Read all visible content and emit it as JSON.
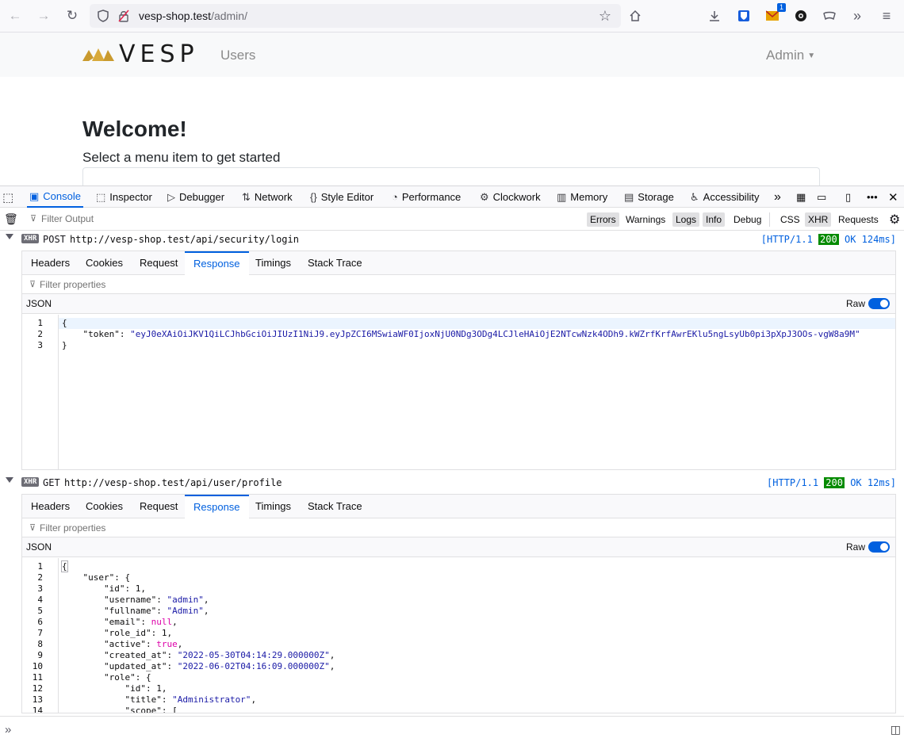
{
  "browser": {
    "url_host": "vesp-shop.test",
    "url_path": "/admin/",
    "extension_badge": "1"
  },
  "app": {
    "brand": "VESP",
    "nav_users": "Users",
    "nav_admin": "Admin"
  },
  "page": {
    "title": "Welcome!",
    "subtitle": "Select a menu item to get started"
  },
  "devtools": {
    "tabs": [
      "Console",
      "Inspector",
      "Debugger",
      "Network",
      "Style Editor",
      "Performance",
      "Clockwork",
      "Memory",
      "Storage",
      "Accessibility"
    ],
    "filter_placeholder": "Filter Output",
    "filters": [
      "Errors",
      "Warnings",
      "Logs",
      "Info",
      "Debug",
      "CSS",
      "XHR",
      "Requests"
    ],
    "active_filters": [
      "Logs",
      "Info",
      "XHR"
    ]
  },
  "requests": [
    {
      "tag": "XHR",
      "method": "POST",
      "url": "http://vesp-shop.test/api/security/login",
      "protocol": "[HTTP/1.1",
      "code": "200",
      "status": "OK 124ms]",
      "tabs": [
        "Headers",
        "Cookies",
        "Request",
        "Response",
        "Timings",
        "Stack Trace"
      ],
      "filter_placeholder": "Filter properties",
      "format": "JSON",
      "raw_label": "Raw",
      "lines": [
        "1",
        "2",
        "3"
      ]
    },
    {
      "tag": "XHR",
      "method": "GET",
      "url": "http://vesp-shop.test/api/user/profile",
      "protocol": "[HTTP/1.1",
      "code": "200",
      "status": "OK 12ms]",
      "tabs": [
        "Headers",
        "Cookies",
        "Request",
        "Response",
        "Timings",
        "Stack Trace"
      ],
      "filter_placeholder": "Filter properties",
      "format": "JSON",
      "raw_label": "Raw",
      "lines": [
        "1",
        "2",
        "3",
        "4",
        "5",
        "6",
        "7",
        "8",
        "9",
        "10",
        "11",
        "12",
        "13",
        "14"
      ]
    }
  ],
  "login_response": {
    "token_key": "\"token\"",
    "token_value": "\"eyJ0eXAiOiJKV1QiLCJhbGciOiJIUzI1NiJ9.eyJpZCI6MSwiaWF0IjoxNjU0NDg3ODg4LCJleHAiOjE2NTcwNzk4ODh9.kWZrfKrfAwrEKlu5ngLsyUb0pi3pXpJ3OOs-vgW8a9M\""
  },
  "profile_response": {
    "user_key": "\"user\"",
    "id": "1",
    "username": "\"admin\"",
    "fullname": "\"Admin\"",
    "email": "null",
    "role_id": "1",
    "active": "true",
    "created_at": "\"2022-05-30T04:14:29.000000Z\"",
    "updated_at": "\"2022-06-02T04:16:09.000000Z\"",
    "role_key": "\"role\"",
    "role_id_val": "1",
    "role_title": "\"Administrator\"",
    "scope_key": "\"scope\""
  }
}
